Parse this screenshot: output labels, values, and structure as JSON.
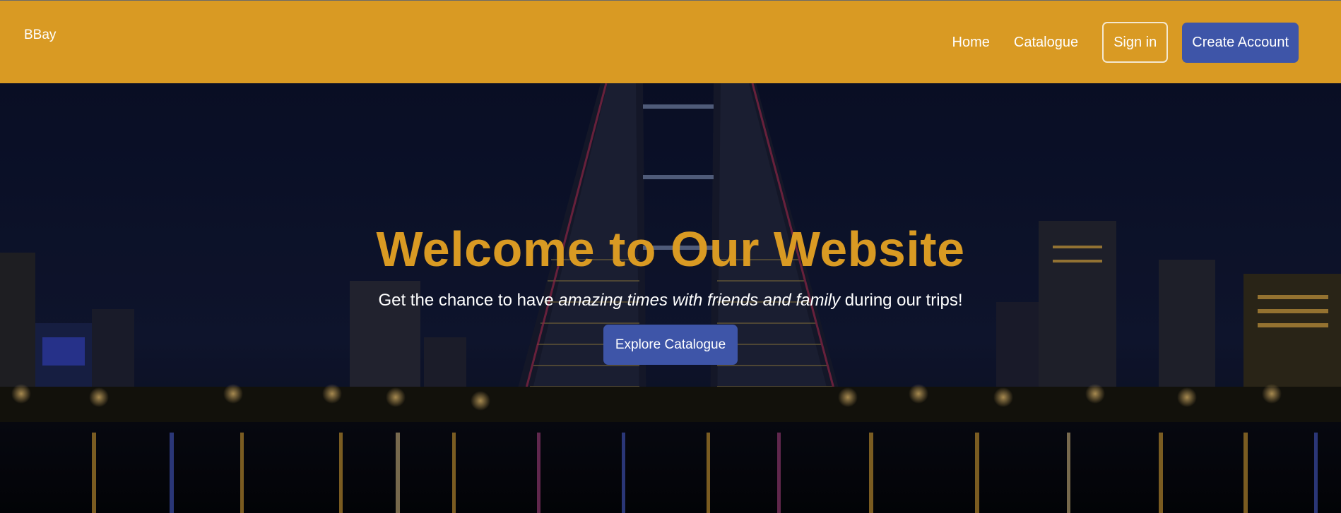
{
  "navbar": {
    "brand": "BBay",
    "links": [
      "Home",
      "Catalogue"
    ],
    "sign_in_label": "Sign in",
    "create_account_label": "Create Account",
    "bg_color": "#d99a23"
  },
  "hero": {
    "title": "Welcome to Our Website",
    "subtitle_start": "Get the chance to have ",
    "subtitle_emphasis": "amazing times with friends and family",
    "subtitle_end": " during our trips!",
    "cta_label": "Explore Catalogue",
    "accent_color": "#d99a23",
    "button_color": "#3e55a8"
  }
}
